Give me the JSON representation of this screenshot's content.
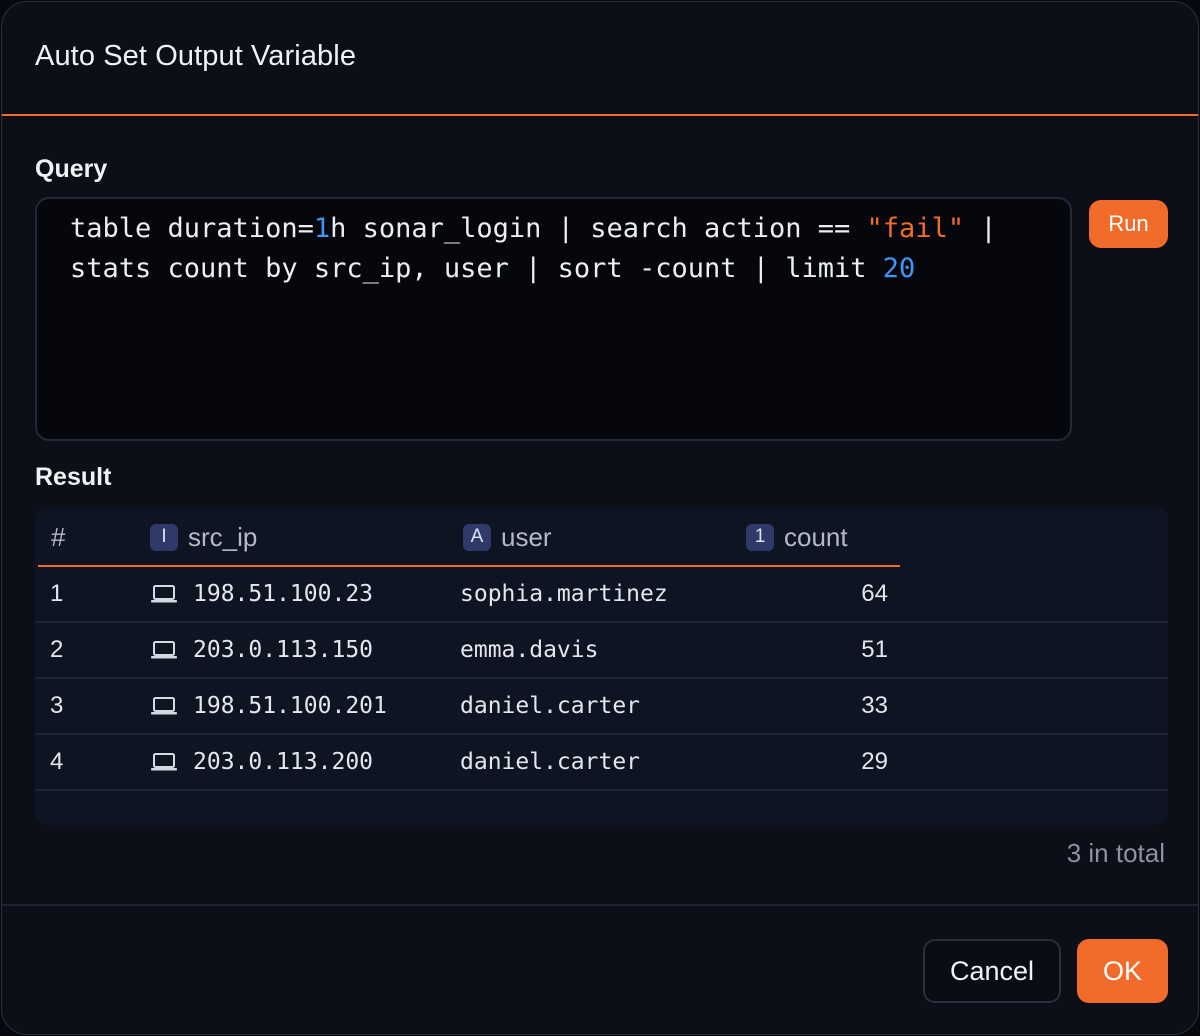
{
  "dialog": {
    "title": "Auto Set Output Variable"
  },
  "query": {
    "label": "Query",
    "line1": {
      "a": "table duration=",
      "b": "1",
      "c": "h sonar_login | search action == ",
      "d": "\"fail\"",
      "e": " |"
    },
    "line2": {
      "a": "stats count by src_ip, user | sort -count | limit ",
      "b": "20"
    },
    "run_label": "Run"
  },
  "result": {
    "label": "Result",
    "columns": [
      {
        "label": "#",
        "badge": ""
      },
      {
        "label": "src_ip",
        "badge": "I"
      },
      {
        "label": "user",
        "badge": "A"
      },
      {
        "label": "count",
        "badge": "1"
      }
    ],
    "rows": [
      {
        "index": "1",
        "src_ip": "198.51.100.23",
        "user": "sophia.martinez",
        "count": "64"
      },
      {
        "index": "2",
        "src_ip": "203.0.113.150",
        "user": "emma.davis",
        "count": "51"
      },
      {
        "index": "3",
        "src_ip": "198.51.100.201",
        "user": "daniel.carter",
        "count": "33"
      },
      {
        "index": "4",
        "src_ip": "203.0.113.200",
        "user": "daniel.carter",
        "count": "29"
      }
    ],
    "total_text": "3 in total",
    "ip_icon": "laptop-icon"
  },
  "footer": {
    "cancel_label": "Cancel",
    "ok_label": "OK"
  },
  "colors": {
    "accent": "#f26b2a",
    "number_token": "#3b97f3",
    "badge": "#2f3a6a"
  }
}
